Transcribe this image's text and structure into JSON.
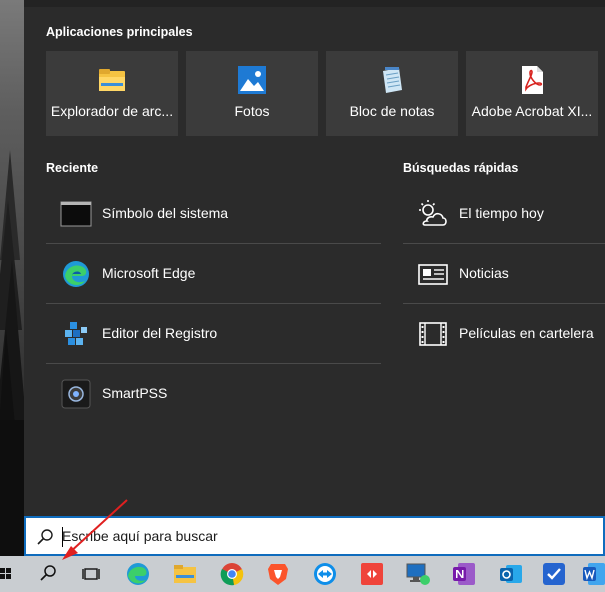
{
  "top_apps": {
    "title": "Aplicaciones principales",
    "items": [
      {
        "label": "Explorador de arc...",
        "icon": "file-explorer-icon"
      },
      {
        "label": "Fotos",
        "icon": "photos-icon"
      },
      {
        "label": "Bloc de notas",
        "icon": "notepad-icon"
      },
      {
        "label": "Adobe Acrobat XI...",
        "icon": "adobe-acrobat-icon"
      }
    ]
  },
  "recent": {
    "title": "Reciente",
    "items": [
      {
        "label": "Símbolo del sistema",
        "icon": "command-prompt-icon"
      },
      {
        "label": "Microsoft Edge",
        "icon": "edge-icon"
      },
      {
        "label": "Editor del Registro",
        "icon": "registry-editor-icon"
      },
      {
        "label": "SmartPSS",
        "icon": "smartpss-icon"
      }
    ]
  },
  "quick_searches": {
    "title": "Búsquedas rápidas",
    "items": [
      {
        "label": "El tiempo hoy",
        "icon": "weather-icon"
      },
      {
        "label": "Noticias",
        "icon": "news-icon"
      },
      {
        "label": "Películas en cartelera",
        "icon": "film-icon"
      }
    ]
  },
  "search": {
    "placeholder": "Escribe aquí para buscar",
    "icon": "search-icon"
  },
  "taskbar": {
    "items": [
      "start-icon",
      "search-icon",
      "task-view-icon",
      "edge-icon",
      "file-explorer-icon",
      "chrome-icon",
      "brave-icon",
      "teamviewer-icon",
      "anydesk-icon",
      "remote-desktop-icon",
      "onenote-icon",
      "outlook-icon",
      "todo-icon",
      "word-icon"
    ]
  },
  "colors": {
    "panel": "#2b2b2b",
    "tile": "#3b3b3b",
    "accent": "#0f6cbd",
    "taskbar": "#c9cdd1",
    "arrow": "#e02020"
  }
}
